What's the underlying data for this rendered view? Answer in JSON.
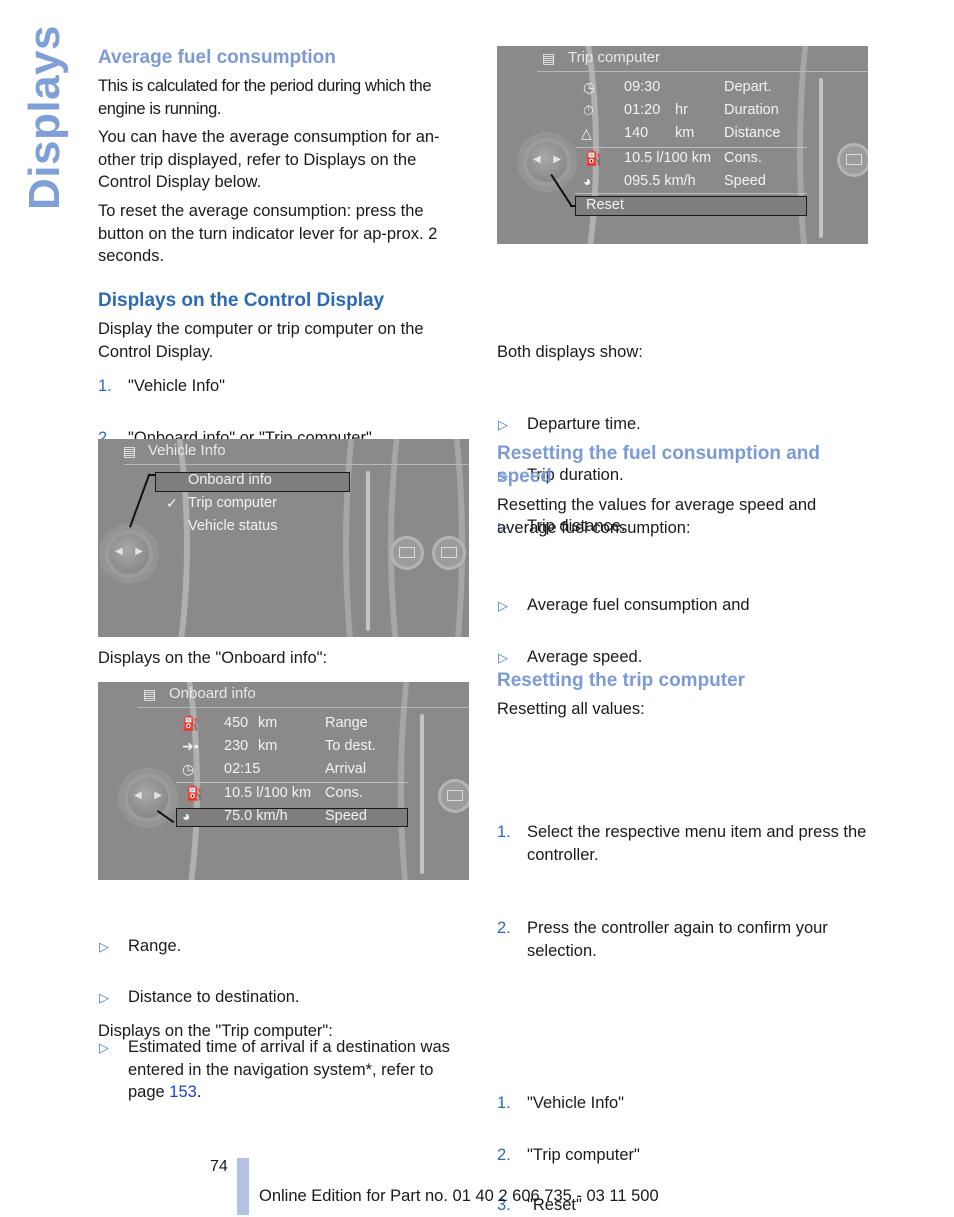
{
  "sidebar": {
    "title": "Displays"
  },
  "left": {
    "avg_heading": "Average fuel consumption",
    "avg_p1": "This is calculated for the period during which the engine is running.",
    "avg_p2": "You can have the average consumption for an-other trip displayed, refer to Displays on the Control Display below.",
    "avg_p3": "To reset the average consumption: press the button on the turn indicator lever for ap-prox. 2 seconds.",
    "cd_heading": "Displays on the Control Display",
    "cd_p1": "Display the computer or trip computer on the Control Display.",
    "cd_steps": [
      {
        "num": "1.",
        "text": "\"Vehicle Info\""
      },
      {
        "num": "2.",
        "text": "\"Onboard info\" or \"Trip computer\""
      }
    ],
    "vehicle_info_screen": {
      "title": "Vehicle Info",
      "items": [
        "Onboard info",
        "Trip computer",
        "Vehicle status"
      ],
      "selected": "Onboard info",
      "checked": "Trip computer"
    },
    "onboard_caption": "Displays on the \"Onboard info\":",
    "onboard_screen": {
      "title": "Onboard info",
      "rows": [
        {
          "icon": "fuel-range-icon",
          "value": "450",
          "unit": "km",
          "label": "Range"
        },
        {
          "icon": "arrow-destination-icon",
          "value": "230",
          "unit": "km",
          "label": "To dest."
        },
        {
          "icon": "arrival-clock-icon",
          "value": "02:15",
          "unit": "",
          "label": "Arrival"
        },
        {
          "icon": "fuel-pump-icon",
          "value": "10.5 l/100 km",
          "unit": "",
          "label": "Cons."
        },
        {
          "icon": "speedometer-icon",
          "value": "75.0 km/h",
          "unit": "",
          "label": "Speed"
        }
      ],
      "selected": "Speed"
    },
    "onboard_bullets": [
      "Range.",
      "Distance to destination.",
      "Estimated time of arrival if a destination was entered in the navigation system*, refer to page "
    ],
    "page_link": "153",
    "trip_caption": "Displays on the \"Trip computer\":"
  },
  "right": {
    "trip_screen": {
      "title": "Trip computer",
      "rows": [
        {
          "icon": "departure-clock-icon",
          "value": "09:30",
          "unit": "",
          "label": "Depart."
        },
        {
          "icon": "stopwatch-icon",
          "value": "01:20",
          "unit": "hr",
          "label": "Duration"
        },
        {
          "icon": "road-distance-icon",
          "value": "140",
          "unit": "km",
          "label": "Distance"
        },
        {
          "icon": "fuel-pump-icon",
          "value": "10.5 l/100 km",
          "unit": "",
          "label": "Cons."
        },
        {
          "icon": "speedometer-icon",
          "value": "095.5 km/h",
          "unit": "",
          "label": "Speed"
        }
      ],
      "reset_label": "Reset"
    },
    "trip_bullets": [
      "Departure time.",
      "Trip duration.",
      "Trip distance."
    ],
    "both_show": "Both displays show:",
    "both_bullets": [
      "Average fuel consumption and",
      "Average speed."
    ],
    "reset_fs_heading": "Resetting the fuel consumption and speed",
    "reset_fs_p": "Resetting the values for average speed and average fuel consumption:",
    "reset_fs_steps": [
      {
        "num": "1.",
        "text": "Select the respective menu item and press the controller."
      },
      {
        "num": "2.",
        "text": "Press the controller again to confirm your selection."
      }
    ],
    "reset_trip_heading": "Resetting the trip computer",
    "reset_trip_p": "Resetting all values:",
    "reset_trip_steps": [
      {
        "num": "1.",
        "text": "\"Vehicle Info\""
      },
      {
        "num": "2.",
        "text": "\"Trip computer\""
      },
      {
        "num": "3.",
        "text": "\"Reset\""
      }
    ]
  },
  "footer": {
    "page_number": "74",
    "edition": "Online Edition for Part no. 01 40 2 606 735 - 03 11 500"
  }
}
